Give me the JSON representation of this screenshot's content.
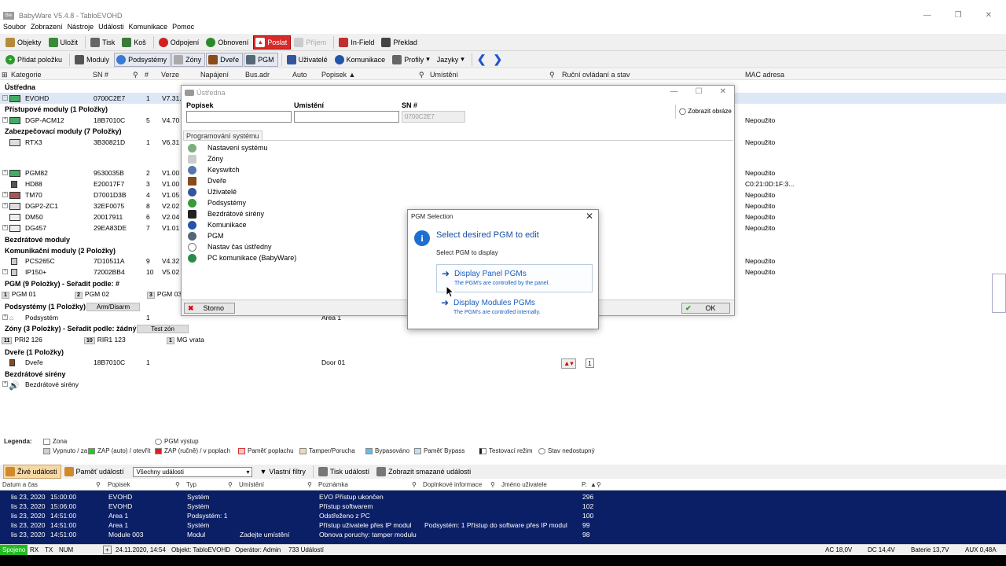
{
  "window": {
    "title": "BabyWare V5.4.8 - TabloEVOHD",
    "app_icon": "Bw"
  },
  "menu": [
    "Soubor",
    "Zobrazení",
    "Nástroje",
    "Události",
    "Komunikace",
    "Pomoc"
  ],
  "toolbar1": [
    {
      "label": "Objekty",
      "icon": "objects-icon",
      "color": "#b58a3a"
    },
    {
      "label": "Uložit",
      "icon": "save-icon",
      "color": "#3a8a3a"
    },
    {
      "label": "Tisk",
      "icon": "print-icon",
      "color": "#666666"
    },
    {
      "label": "Koš",
      "icon": "trash-icon",
      "color": "#3a7a3a"
    },
    {
      "label": "Odpojení",
      "icon": "disconnect-icon",
      "color": "#d02020"
    },
    {
      "label": "Obnovení",
      "icon": "refresh-icon",
      "color": "#2a8a2a"
    },
    {
      "label": "Poslat",
      "icon": "send-icon",
      "color": "#d92a2a"
    },
    {
      "label": "Příjem",
      "icon": "receive-icon",
      "color": "#aaaaaa"
    },
    {
      "label": "In-Field",
      "icon": "infield-icon",
      "color": "#c03030"
    },
    {
      "label": "Překlad",
      "icon": "translate-icon",
      "color": "#444444"
    }
  ],
  "toolbar2": [
    {
      "label": "Přidat položku",
      "icon": "add-icon",
      "color": "#2a9a2a"
    },
    {
      "label": "Moduly",
      "icon": "modules-icon",
      "color": "#555555"
    },
    {
      "label": "Podsystémy",
      "icon": "partitions-icon",
      "color": "#3a7ad0"
    },
    {
      "label": "Zóny",
      "icon": "zones-icon",
      "color": "#888888"
    },
    {
      "label": "Dveře",
      "icon": "door-icon",
      "color": "#8a4a1a"
    },
    {
      "label": "PGM",
      "icon": "pgm-icon",
      "color": "#556677"
    },
    {
      "label": "Uživatelé",
      "icon": "users-icon",
      "color": "#335599"
    },
    {
      "label": "Komunikace",
      "icon": "communication-icon",
      "color": "#2255aa"
    },
    {
      "label": "Profily",
      "icon": "profiles-icon",
      "color": "#666666"
    },
    {
      "label": "Jazyky",
      "icon": "languages-icon",
      "color": "#888888"
    }
  ],
  "columns": {
    "kategorie": "Kategorie",
    "sn": "SN #",
    "num": "#",
    "verze": "Verze",
    "napajeni": "Napájení",
    "busadr": "Bus.adr",
    "auto": "Auto",
    "popisek": "Popisek ▲",
    "umisteni": "Umístění",
    "rucni": "Ruční ovládaní a stav",
    "mac": "MAC adresa"
  },
  "tree": {
    "ustredna": "Ústředna",
    "evohd": {
      "name": "EVOHD",
      "sn": "0700C2E7",
      "num": "1",
      "ver": "V7.31.0"
    },
    "pristupove": "Přístupové moduly (1 Položky)",
    "dgp": {
      "name": "DGP-ACM12",
      "sn": "18B7010C",
      "num": "5",
      "ver": "V4.70",
      "mac": "Nepoužito"
    },
    "zabezpecovaci": "Zabezpečovací moduly (7 Položky)",
    "rtx3": {
      "name": "RTX3",
      "sn": "3B30821D",
      "num": "1",
      "ver": "V6.31",
      "mac": "Nepoužito"
    },
    "pgm82": {
      "name": "PGM82",
      "sn": "9530035B",
      "num": "2",
      "ver": "V1.00",
      "mac": "Nepoužito"
    },
    "hd88": {
      "name": "HD88",
      "sn": "E20017F7",
      "num": "3",
      "ver": "V1.00",
      "mac": "C0:21:0D:1F:3..."
    },
    "tm70": {
      "name": "TM70",
      "sn": "D7001D3B",
      "num": "4",
      "ver": "V1.05",
      "mac": "Nepoužito"
    },
    "dgp2": {
      "name": "DGP2-ZC1",
      "sn": "32EF0075",
      "num": "8",
      "ver": "V2.02",
      "mac": "Nepoužito"
    },
    "dm50": {
      "name": "DM50",
      "sn": "20017911",
      "num": "6",
      "ver": "V2.04",
      "mac": "Nepoužito"
    },
    "dg457": {
      "name": "DG457",
      "sn": "29EA83DE",
      "num": "7",
      "ver": "V1.01",
      "mac": "Nepoužito"
    },
    "bezdratove": "Bezdrátové moduly",
    "komunikacni": "Komunikační moduly (2 Položky)",
    "pcs": {
      "name": "PCS265C",
      "sn": "7D10511A",
      "num": "9",
      "ver": "V4.32",
      "mac": "Nepoužito"
    },
    "ip150": {
      "name": "IP150+",
      "sn": "72002BB4",
      "num": "10",
      "ver": "V5.02",
      "mac": "Nepoužito"
    },
    "pgm_group": "PGM (9 Položky) - Seřadit podle: #",
    "pgm_items": [
      {
        "n": "1",
        "l": "PGM 01"
      },
      {
        "n": "2",
        "l": "PGM 02"
      },
      {
        "n": "3",
        "l": "PGM 03"
      }
    ],
    "podsystemy": "Podsystémy (1 Položky)",
    "arm_btn": "Arm/Disarm",
    "podsystem": {
      "name": "Podsystém",
      "num": "1",
      "popisek": "Area 1"
    },
    "zony": "Zóny (3 Položky) - Seřadit podle: žádný",
    "test_btn": "Test zón",
    "zone_items": [
      {
        "n": "11",
        "l": "PRI2 126"
      },
      {
        "n": "10",
        "l": "RIR1 123"
      },
      {
        "n": "1",
        "l": "MG vrata"
      }
    ],
    "dvere": "Dveře (1 Položky)",
    "door": {
      "name": "Dveře",
      "sn": "18B7010C",
      "num": "1",
      "popisek": "Door 01"
    },
    "sireny": "Bezdrátové sirény",
    "sirena": {
      "name": "Bezdrátové sirény"
    }
  },
  "dialog": {
    "title": "Ústředna",
    "popisek_label": "Popisek",
    "umisteni_label": "Umístění",
    "sn_label": "SN #",
    "sn_value": "0700C2E7",
    "show_images": "Zobrazit obráze",
    "tab": "Programování systému",
    "items": [
      {
        "label": "Nastavení systému",
        "color": "#7ab07a"
      },
      {
        "label": "Zóny",
        "color": "#cccccc"
      },
      {
        "label": "Keyswitch",
        "color": "#5577aa"
      },
      {
        "label": "Dveře",
        "color": "#8a4a1a"
      },
      {
        "label": "Uživatelé",
        "color": "#335599"
      },
      {
        "label": "Podsystémy",
        "color": "#3a9a3a"
      },
      {
        "label": "Bezdrátové sirény",
        "color": "#222222"
      },
      {
        "label": "Komunikace",
        "color": "#2255aa"
      },
      {
        "label": "PGM",
        "color": "#556677"
      },
      {
        "label": "Nastav čas ústředny",
        "color": "#777777"
      },
      {
        "label": "PC komunikace (BabyWare)",
        "color": "#2a8a4a"
      }
    ],
    "cancel": "Storno",
    "ok": "OK"
  },
  "pgm_dialog": {
    "title": "PGM Selection",
    "heading": "Select desired PGM to edit",
    "sub": "Select PGM to display",
    "options": [
      {
        "label": "Display Panel PGMs",
        "desc": "The PGM's are controlled by the panel."
      },
      {
        "label": "Display Modules PGMs",
        "desc": "The PGM's are controlled internally."
      }
    ]
  },
  "legend": {
    "title": "Legenda:",
    "items1": [
      {
        "label": "Zona",
        "color": "#ffffff"
      },
      {
        "label": "PGM výstup",
        "color": "#ffffff"
      }
    ],
    "items2": [
      {
        "label": "Vypnuto / za",
        "color": "#d0d0d0"
      },
      {
        "label": "ZAP (auto) / otevřít",
        "color": "#22cc22"
      },
      {
        "label": "ZAP (ručně) / v poplach",
        "color": "#e02020"
      },
      {
        "label": "Paměť poplachu",
        "color": "#f3c8c8"
      },
      {
        "label": "Tamper/Porucha",
        "color": "#f0d8b0"
      },
      {
        "label": "Bypasováno",
        "color": "#66bbee"
      },
      {
        "label": "Paměť Bypass",
        "color": "#bfe0f5"
      },
      {
        "label": "Testovací režim",
        "color": "#222222"
      },
      {
        "label": "Stav nedostupný",
        "color": "#ffffff"
      }
    ]
  },
  "events_toolbar": {
    "live": "Živé události",
    "memory": "Paměť událostí",
    "filter_value": "Všechny události",
    "custom_filters": "Vlastní filtry",
    "print": "Tisk událostí",
    "show_deleted": "Zobrazit smazané události"
  },
  "events_header": {
    "date": "Datum a čas",
    "popisek": "Popisek",
    "typ": "Typ",
    "umisteni": "Umístění",
    "poznamka": "Poznámka",
    "doplnkove": "Doplnkové informace",
    "jmeno": "Jméno uživatele",
    "p": "P."
  },
  "events": [
    {
      "date": "lis 23, 2020",
      "time": "15:00:00",
      "popisek": "EVOHD",
      "typ": "Systém",
      "umisteni": "",
      "poznamka": "EVO Přístup ukončen",
      "dopl": "",
      "num": "296"
    },
    {
      "date": "lis 23, 2020",
      "time": "15:06:00",
      "popisek": "EVOHD",
      "typ": "Systém",
      "umisteni": "",
      "poznamka": "Přístup softwarem",
      "dopl": "",
      "num": "102"
    },
    {
      "date": "lis 23, 2020",
      "time": "14:51:00",
      "popisek": "Area 1",
      "typ": "Podsystém: 1",
      "umisteni": "",
      "poznamka": "Odstřeženo z PC",
      "dopl": "",
      "num": "100"
    },
    {
      "date": "lis 23, 2020",
      "time": "14:51:00",
      "popisek": "Area 1",
      "typ": "Systém",
      "umisteni": "",
      "poznamka": "Přístup uživatele přes IP modul",
      "dopl": "Podsystém: 1 Přístup do software přes IP modul",
      "num": "99"
    },
    {
      "date": "lis 23, 2020",
      "time": "14:51:00",
      "popisek": "Module 003",
      "typ": "Modul",
      "umisteni": "Zadejte umístění",
      "poznamka": "Obnova poruchy: tamper modulu",
      "dopl": "",
      "num": "98"
    }
  ],
  "status": {
    "conn": "Spojeno",
    "rx": "RX",
    "tx": "TX",
    "num": "NUM",
    "datetime": "24.11.2020, 14:54",
    "object": "Objekt: TabloEVOHD",
    "operator": "Operátor: Admin",
    "events": "733 Událostí",
    "ac": "AC 18,0V",
    "dc": "DC 14,4V",
    "battery": "Baterie 13,7V",
    "aux": "AUX 0,48A"
  }
}
